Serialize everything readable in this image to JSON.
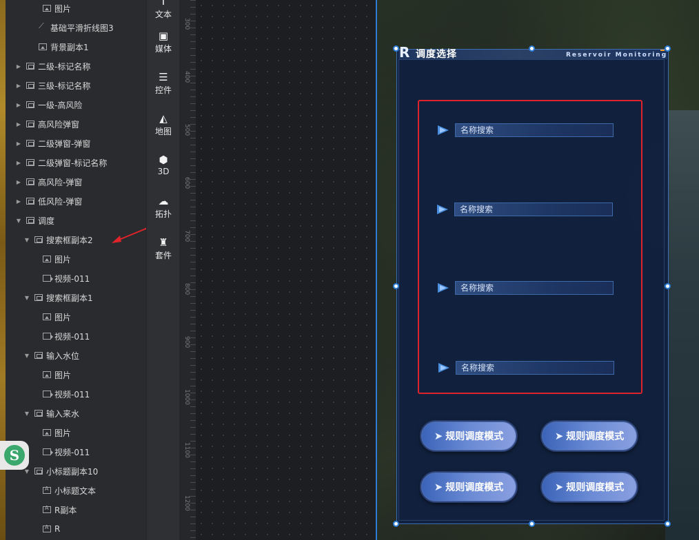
{
  "layers": [
    {
      "label": "图片",
      "icon": "img",
      "indent": 2,
      "arrow": ""
    },
    {
      "label": "基础平滑折线图3",
      "icon": "line",
      "indent": 1.5,
      "arrow": ""
    },
    {
      "label": "背景副本1",
      "icon": "img",
      "indent": 1.5,
      "arrow": ""
    },
    {
      "label": "二级-标记名称",
      "icon": "group",
      "indent": 0,
      "arrow": "▶"
    },
    {
      "label": "三级-标记名称",
      "icon": "group",
      "indent": 0,
      "arrow": "▶"
    },
    {
      "label": "一级-高风险",
      "icon": "group",
      "indent": 0,
      "arrow": "▶"
    },
    {
      "label": "高风险弹窗",
      "icon": "group",
      "indent": 0,
      "arrow": "▶"
    },
    {
      "label": "二级弹窗-弹窗",
      "icon": "group",
      "indent": 0,
      "arrow": "▶"
    },
    {
      "label": "二级弹窗-标记名称",
      "icon": "group",
      "indent": 0,
      "arrow": "▶"
    },
    {
      "label": "高风险-弹窗",
      "icon": "group",
      "indent": 0,
      "arrow": "▶"
    },
    {
      "label": "低风险-弹窗",
      "icon": "group",
      "indent": 0,
      "arrow": "▶"
    },
    {
      "label": "调度",
      "icon": "group",
      "indent": 0,
      "arrow": "▼"
    },
    {
      "label": "搜索框副本2",
      "icon": "group",
      "indent": 1,
      "arrow": "▼"
    },
    {
      "label": "图片",
      "icon": "img",
      "indent": 2,
      "arrow": ""
    },
    {
      "label": "视频-011",
      "icon": "video",
      "indent": 2,
      "arrow": ""
    },
    {
      "label": "搜索框副本1",
      "icon": "group",
      "indent": 1,
      "arrow": "▼"
    },
    {
      "label": "图片",
      "icon": "img",
      "indent": 2,
      "arrow": ""
    },
    {
      "label": "视频-011",
      "icon": "video",
      "indent": 2,
      "arrow": ""
    },
    {
      "label": "输入水位",
      "icon": "group",
      "indent": 1,
      "arrow": "▼"
    },
    {
      "label": "图片",
      "icon": "img",
      "indent": 2,
      "arrow": ""
    },
    {
      "label": "视频-011",
      "icon": "video",
      "indent": 2,
      "arrow": ""
    },
    {
      "label": "输入来水",
      "icon": "group",
      "indent": 1,
      "arrow": "▼"
    },
    {
      "label": "图片",
      "icon": "img",
      "indent": 2,
      "arrow": ""
    },
    {
      "label": "视频-011",
      "icon": "video",
      "indent": 2,
      "arrow": ""
    },
    {
      "label": "小标题副本10",
      "icon": "group",
      "indent": 1,
      "arrow": "▼"
    },
    {
      "label": "小标题文本",
      "icon": "text",
      "indent": 2,
      "arrow": ""
    },
    {
      "label": "R副本",
      "icon": "text",
      "indent": 2,
      "arrow": ""
    },
    {
      "label": "R",
      "icon": "text",
      "indent": 2,
      "arrow": ""
    }
  ],
  "tools": [
    {
      "label": "文本",
      "icon": "text-icon",
      "glyph": "T"
    },
    {
      "label": "媒体",
      "icon": "camera-icon",
      "glyph": "▣"
    },
    {
      "label": "控件",
      "icon": "controls-icon",
      "glyph": "☰"
    },
    {
      "label": "地图",
      "icon": "map-icon",
      "glyph": "◭"
    },
    {
      "label": "3D",
      "icon": "cube-icon",
      "glyph": "⬢"
    },
    {
      "label": "拓扑",
      "icon": "topology-icon",
      "glyph": "☁"
    },
    {
      "label": "套件",
      "icon": "shirt-icon",
      "glyph": "♜"
    }
  ],
  "ruler_labels": [
    "300",
    "400",
    "500",
    "600",
    "700",
    "800",
    "900",
    "1000",
    "1100",
    "1200"
  ],
  "panel": {
    "logo": "R",
    "title": "调度选择",
    "subtitle": "Reservoir Monitoring",
    "searches": [
      "名称搜索",
      "名称搜索",
      "名称搜索",
      "名称搜索"
    ],
    "buttons": [
      "规则调度模式",
      "规则调度模式",
      "规则调度模式",
      "规则调度模式"
    ]
  },
  "logo_badge": "S",
  "colors": {
    "selection": "#2d7dd6",
    "highlight": "#e0232a",
    "panel_bg": "#11203e",
    "button_accent": "#6a8ad4"
  }
}
